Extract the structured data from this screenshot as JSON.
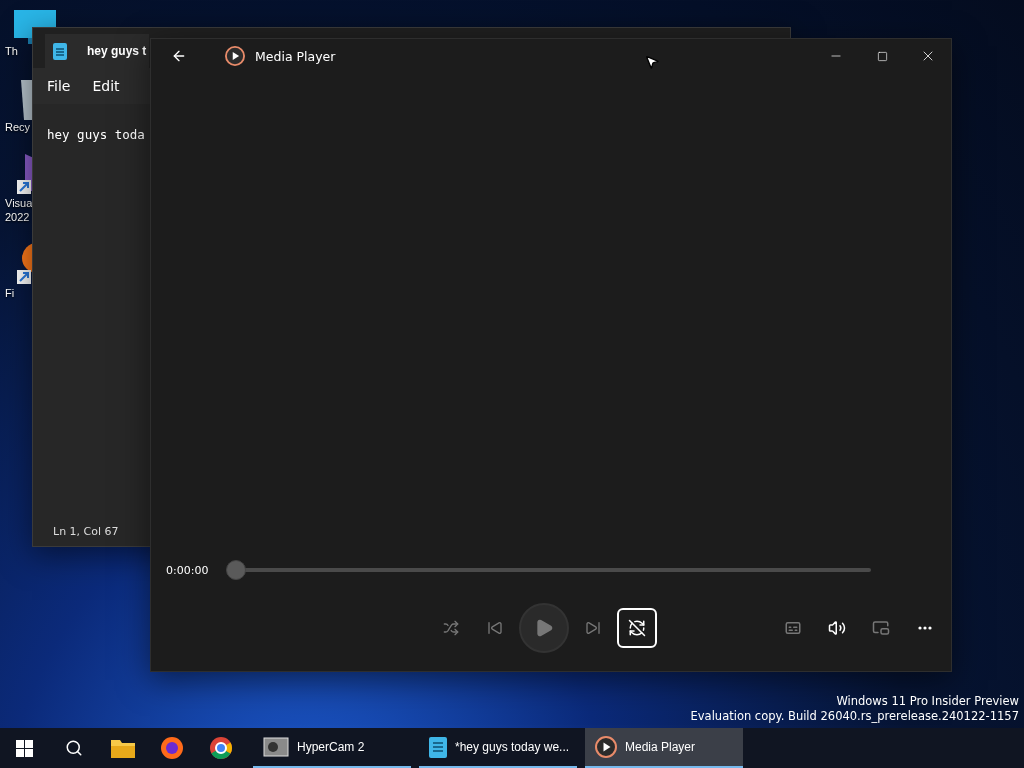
{
  "desktop": {
    "icons": [
      {
        "kind": "monitor",
        "lines": [
          "Th"
        ]
      },
      {
        "kind": "bin",
        "lines": [
          "Recy"
        ]
      },
      {
        "kind": "studio",
        "lines": [
          "Visua",
          "2022"
        ]
      },
      {
        "kind": "firefox",
        "lines": [
          "Fi"
        ]
      }
    ]
  },
  "notepad": {
    "tab_title": "hey guys t",
    "menu": [
      "File",
      "Edit"
    ],
    "text": "hey guys toda",
    "status": "Ln 1, Col 67"
  },
  "media_player": {
    "title": "Media Player",
    "time": "0:00:00",
    "seek": {
      "level": 0
    },
    "transport": [
      {
        "kind": "shuffle",
        "disabled": true,
        "selected": false
      },
      {
        "kind": "previous",
        "disabled": true,
        "selected": false
      },
      {
        "kind": "play",
        "disabled": true,
        "selected": false
      },
      {
        "kind": "next",
        "disabled": true,
        "selected": false
      },
      {
        "kind": "repeat",
        "disabled": false,
        "selected": true
      }
    ],
    "extras": [
      {
        "kind": "captions",
        "disabled": true
      },
      {
        "kind": "volume",
        "disabled": false
      },
      {
        "kind": "miniplayer",
        "disabled": true
      },
      {
        "kind": "more",
        "disabled": false
      }
    ]
  },
  "watermark": [
    "Windows 11 Pro Insider Preview",
    "Evaluation copy. Build 26040.rs_prerelease.240122-1157"
  ],
  "taskbar": {
    "pinned": [
      {
        "kind": "start"
      },
      {
        "kind": "search"
      },
      {
        "kind": "folder"
      },
      {
        "kind": "firefox"
      },
      {
        "kind": "chrome"
      }
    ],
    "apps": [
      {
        "kind": "camera",
        "label": "HyperCam 2",
        "selected": false
      },
      {
        "kind": "notepad",
        "label": "*hey guys today we...",
        "selected": false
      },
      {
        "kind": "player",
        "label": "Media Player",
        "selected": true
      }
    ]
  }
}
